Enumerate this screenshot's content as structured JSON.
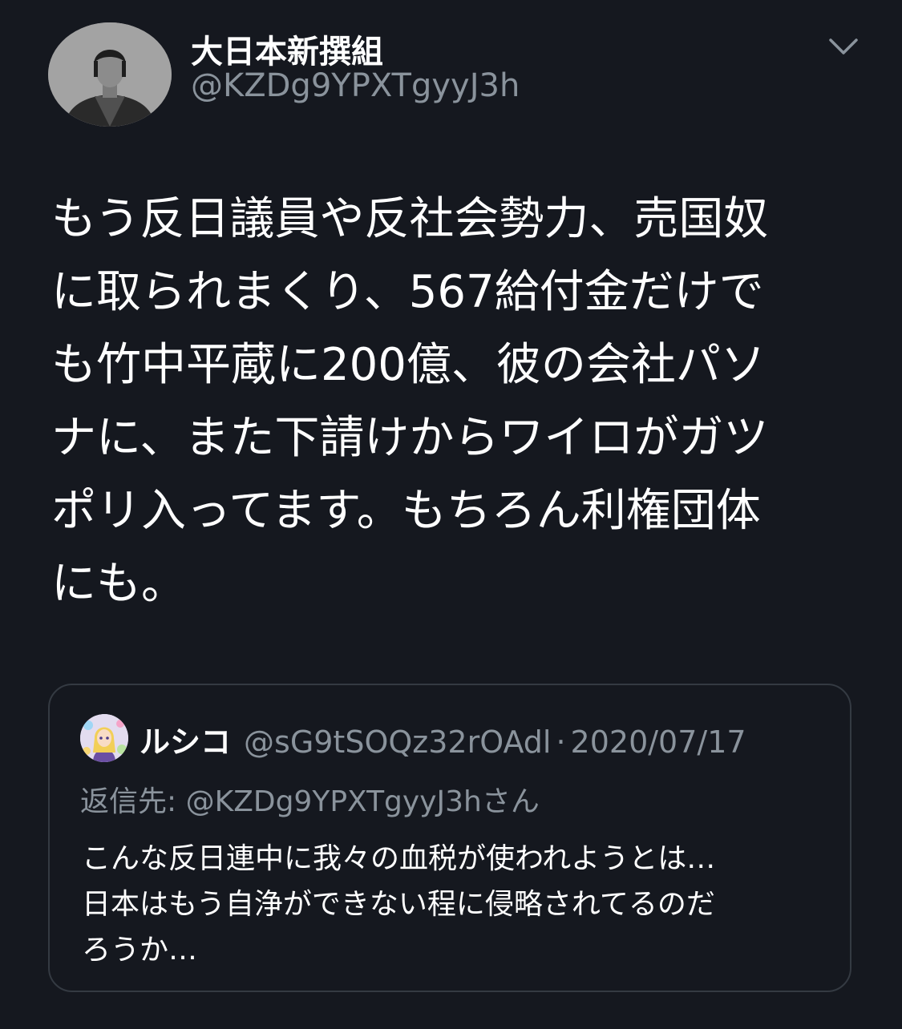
{
  "tweet": {
    "author": {
      "display_name": "大日本新撰組",
      "handle": "@KZDg9YPXTgyyJ3h",
      "avatar_icon": "portrait-photo-avatar"
    },
    "menu_icon": "chevron-down-icon",
    "body_lines": [
      "もう反日議員や反社会勢力、売国奴",
      "に取られまくり、567給付金だけで",
      "も竹中平蔵に200億、彼の会社パソ",
      "ナに、また下請けからワイロがガツ",
      "ポリ入ってます。もちろん利権団体",
      "にも。"
    ]
  },
  "quoted_tweet": {
    "display_name": "ルシコ",
    "handle": "@sG9tSOQz32rOAdl",
    "separator": "·",
    "date": "2020/07/17",
    "reply_to_label": "返信先:",
    "reply_to_handle": "@KZDg9YPXTgyyJ3h",
    "reply_to_suffix": "さん",
    "body_lines": [
      "こんな反日連中に我々の血税が使われようとは…",
      "日本はもう自浄ができない程に侵略されてるのだ",
      "ろうか…"
    ]
  },
  "colors": {
    "background": "#15181f",
    "primary_text": "#ffffff",
    "secondary_text": "#8a939c",
    "card_border": "#343a42"
  }
}
